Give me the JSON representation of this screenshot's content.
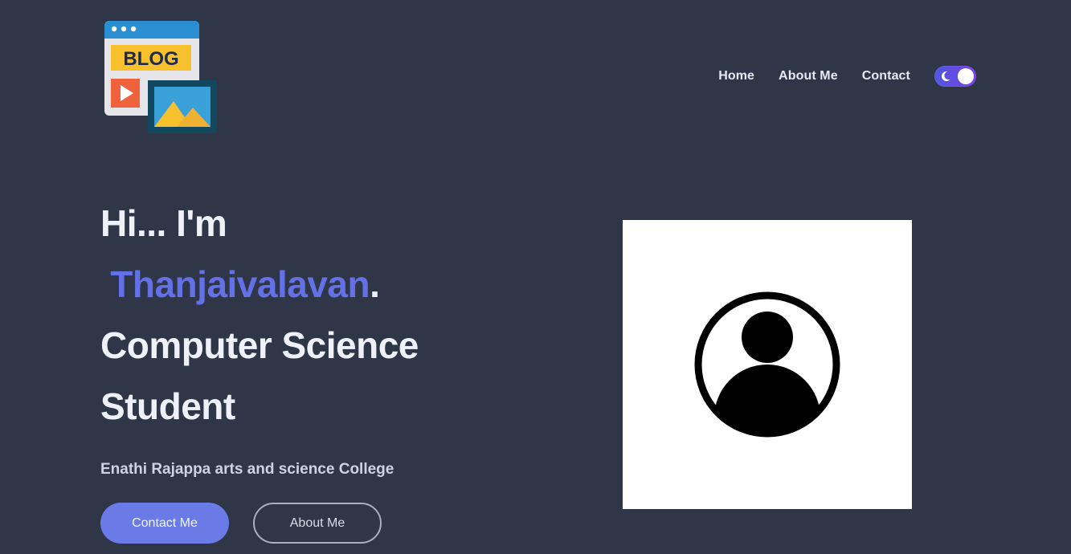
{
  "header": {
    "logo_text": "BLOG",
    "nav": [
      {
        "label": "Home"
      },
      {
        "label": "About Me"
      },
      {
        "label": "Contact"
      }
    ],
    "theme_toggle_icon": "moon-icon"
  },
  "hero": {
    "greeting": "Hi... I'm",
    "name": "Thanjaivalavan",
    "name_suffix": ".",
    "role_line1": "Computer Science",
    "role_line2": "Student",
    "college": "Enathi Rajappa arts and science College",
    "primary_button": "Contact Me",
    "secondary_button": "About Me"
  },
  "profile": {
    "icon": "user-avatar-icon"
  },
  "colors": {
    "background": "#2e3648",
    "accent": "#6470e6",
    "button": "#6a7be8"
  }
}
